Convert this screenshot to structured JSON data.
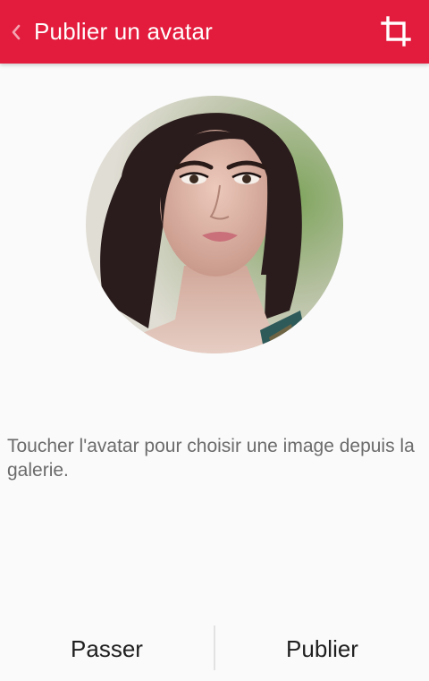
{
  "header": {
    "title": "Publier un avatar",
    "back_icon": "chevron-left-icon",
    "crop_icon": "crop-icon",
    "background_color": "#e31c3d"
  },
  "avatar": {
    "description": "profile-photo"
  },
  "hint": {
    "text": "Toucher l'avatar pour choisir une image depuis la galerie."
  },
  "actions": {
    "skip_label": "Passer",
    "publish_label": "Publier"
  }
}
